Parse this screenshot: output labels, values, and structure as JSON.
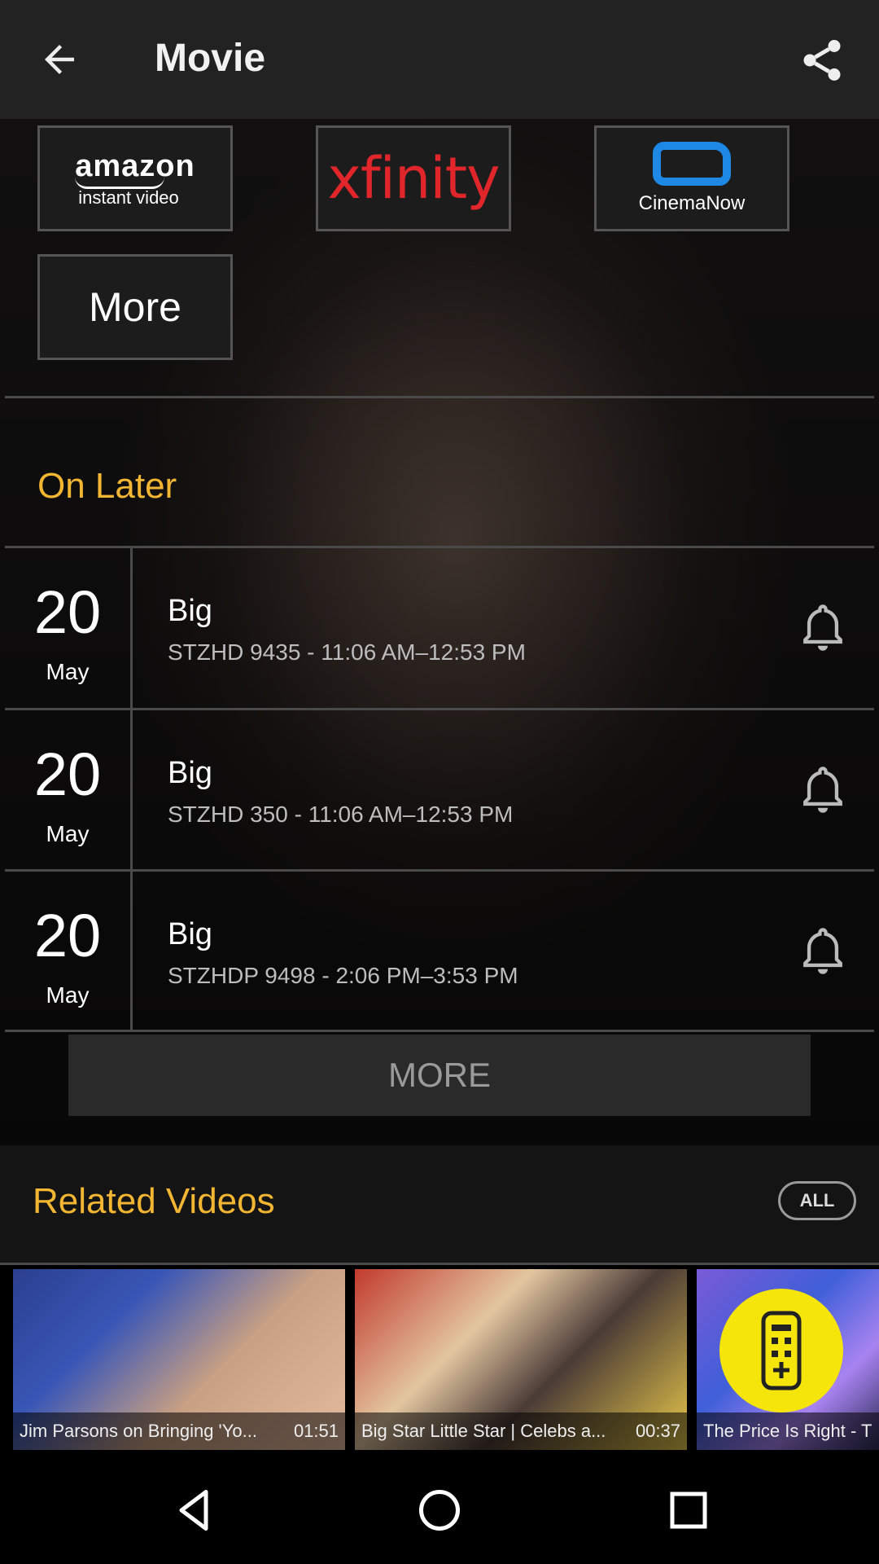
{
  "appbar": {
    "title": "Movie",
    "back_icon": "arrow-left-icon",
    "share_icon": "share-icon"
  },
  "providers": {
    "amazon": {
      "line1": "amazon",
      "line2": "instant video"
    },
    "xfinity": {
      "label": "xfinity"
    },
    "cinemanow": {
      "label": "CinemaNow"
    },
    "more_label": "More"
  },
  "on_later": {
    "title": "On Later",
    "rows": [
      {
        "day": "20",
        "month": "May",
        "title": "Big",
        "detail": "STZHD 9435 - 11:06 AM–12:53 PM"
      },
      {
        "day": "20",
        "month": "May",
        "title": "Big",
        "detail": "STZHD 350 - 11:06 AM–12:53 PM"
      },
      {
        "day": "20",
        "month": "May",
        "title": "Big",
        "detail": "STZHDP 9498 - 2:06 PM–3:53 PM"
      }
    ],
    "more_button": "MORE"
  },
  "related": {
    "title": "Related Videos",
    "all_button": "ALL",
    "videos": [
      {
        "title": "Jim Parsons on Bringing 'Yo...",
        "duration": "01:51"
      },
      {
        "title": "Big Star Little Star | Celebs a...",
        "duration": "00:37"
      },
      {
        "title": "The Price Is Right - T",
        "duration": ""
      }
    ]
  },
  "colors": {
    "accent": "#f2b632",
    "fab": "#f5e50b",
    "xfinity": "#e0262b",
    "cinemanow": "#1e88e5"
  }
}
